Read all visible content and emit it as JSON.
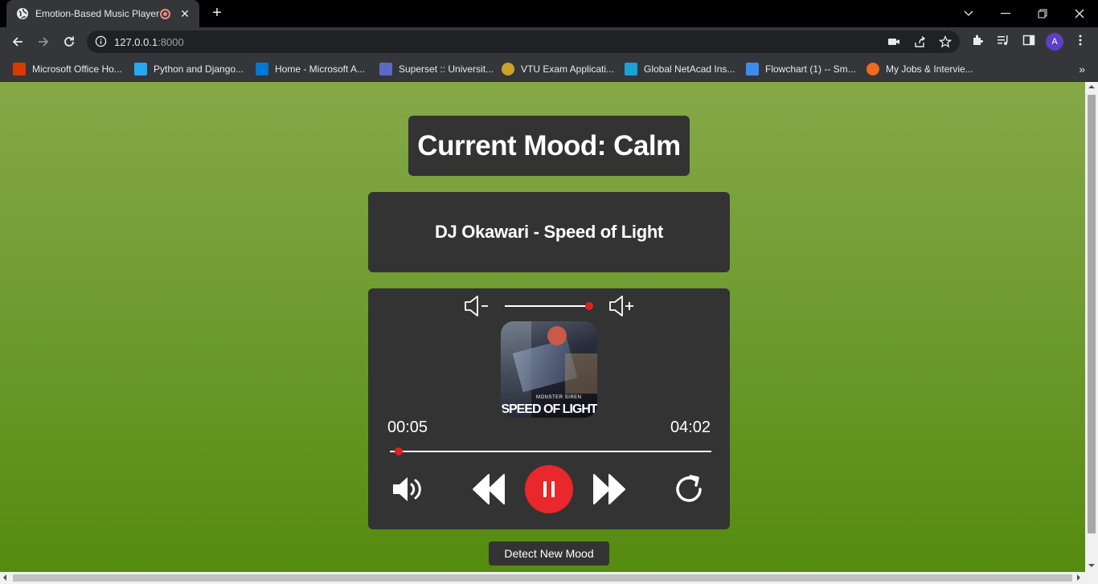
{
  "browser": {
    "tab_title": "Emotion-Based Music Player",
    "url_host": "127.0.0.1",
    "url_port": ":8000",
    "profile_initial": "A",
    "bookmarks": [
      {
        "label": "Microsoft Office Ho...",
        "icon": "office-icon",
        "color": "#d83b01"
      },
      {
        "label": "Python and Django...",
        "icon": "vscode-icon",
        "color": "#23a9f2"
      },
      {
        "label": "Home - Microsoft A...",
        "icon": "azure-icon",
        "color": "#0078d4"
      },
      {
        "label": "Superset :: Universit...",
        "icon": "superset-icon",
        "color": "#5c6bc0"
      },
      {
        "label": "VTU Exam Applicati...",
        "icon": "vtu-icon",
        "color": "#c9a227"
      },
      {
        "label": "Global NetAcad Ins...",
        "icon": "cisco-icon",
        "color": "#1ba0d7"
      },
      {
        "label": "Flowchart (1) -- Sm...",
        "icon": "smartdraw-icon",
        "color": "#3d8bf2"
      },
      {
        "label": "My Jobs & Intervie...",
        "icon": "jobs-icon",
        "color": "#f26a21"
      }
    ]
  },
  "app": {
    "mood_title": "Current Mood: Calm",
    "song_title": "DJ Okawari - Speed of Light",
    "cover_brand": "MONSTER SIREN",
    "cover_title": "SPEED OF LIGHT",
    "current_time": "00:05",
    "duration": "04:02",
    "progress": 0.02,
    "volume": 1.0,
    "detect_button": "Detect New Mood",
    "accent_color": "#e8282b",
    "panel_color": "#333333"
  }
}
